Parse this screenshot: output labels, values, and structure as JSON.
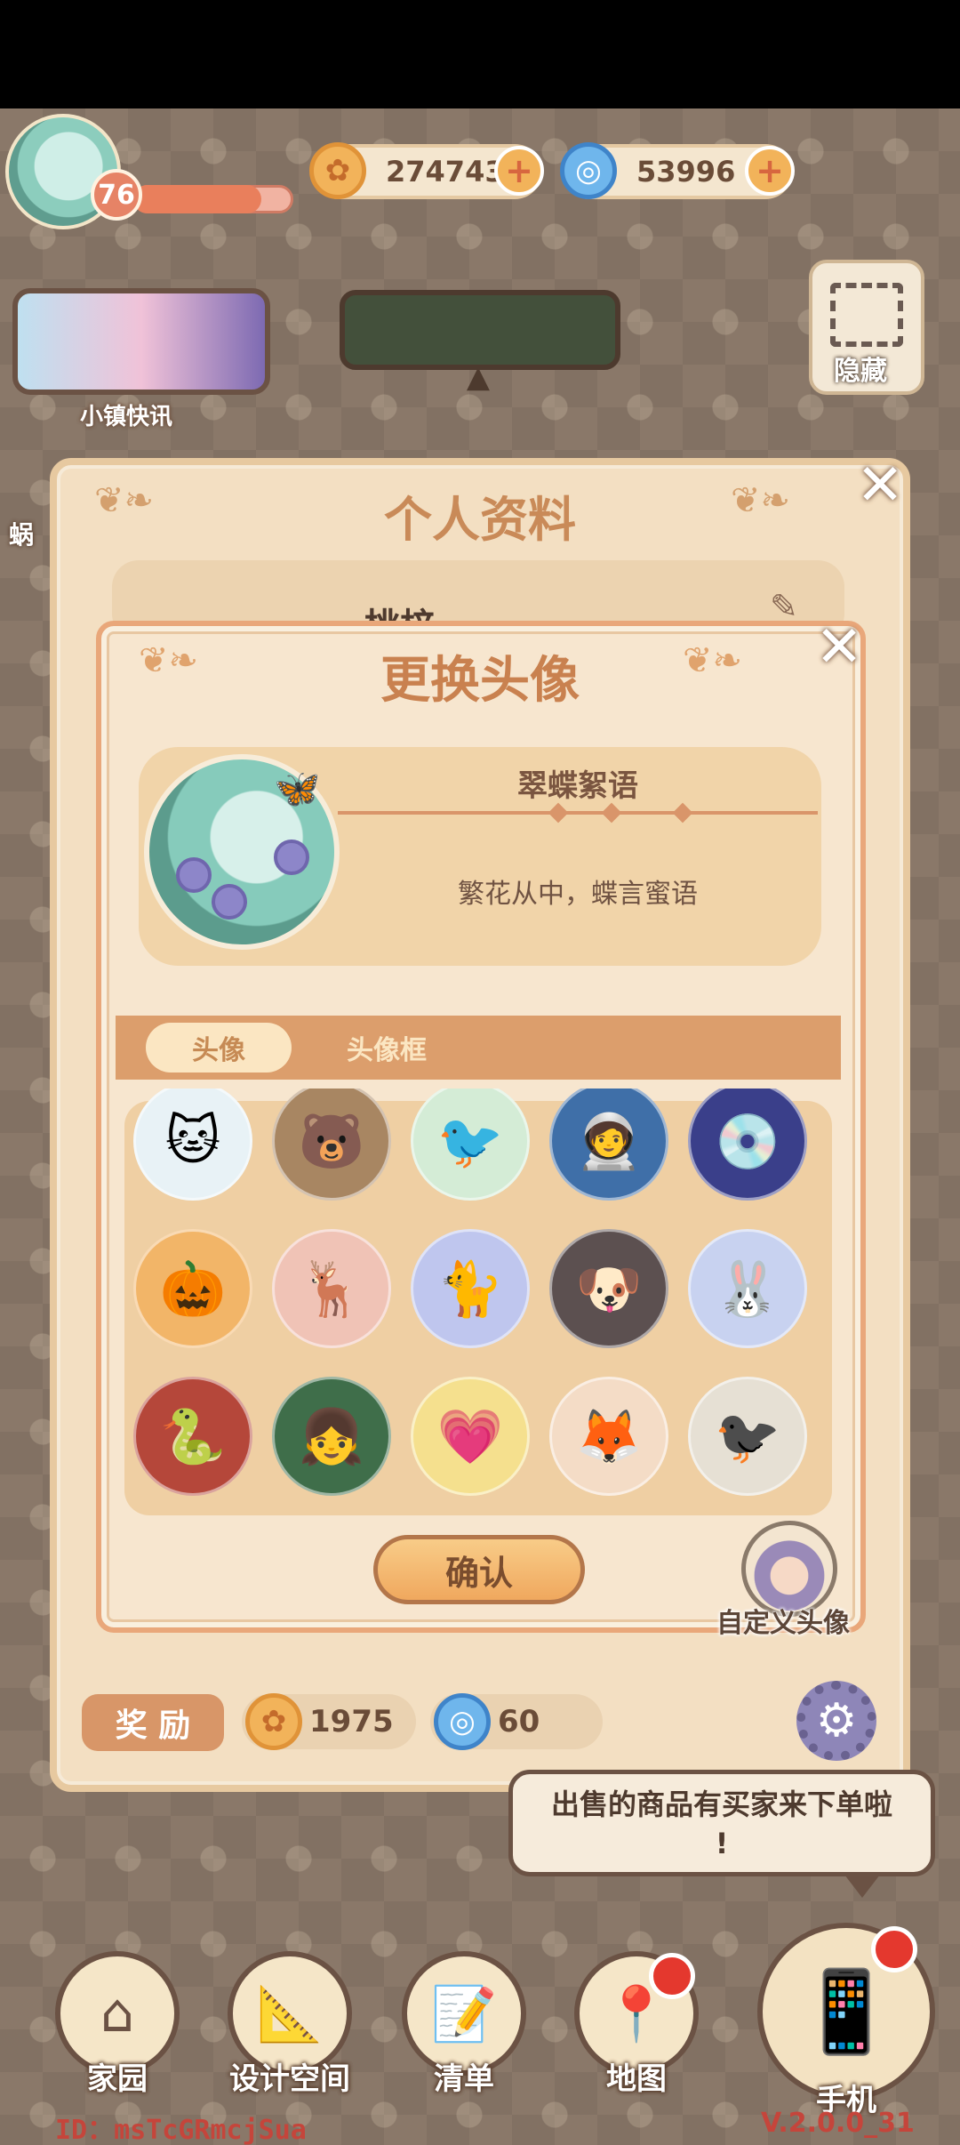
{
  "hud": {
    "level": "76",
    "xp_progress": 0.8,
    "coins": "274743",
    "gems": "53996",
    "news_label": "小镇快讯",
    "hide_label": "隐藏",
    "left_partial_label": "蜗"
  },
  "profile_panel": {
    "title": "个人资料",
    "name_partial": "桃梓",
    "reward_label": "奖 励",
    "reward_coins": "1975",
    "reward_gems": "60"
  },
  "avatar_dialog": {
    "title": "更换头像",
    "selected_name": "翠蝶絮语",
    "selected_desc": "繁花从中，蝶言蜜语",
    "tabs": [
      {
        "label": "头像",
        "active": true
      },
      {
        "label": "头像框",
        "active": false
      }
    ],
    "avatars": [
      {
        "name": "white-cat-avatar",
        "glyph": "🐱",
        "bg": "#e8f2f6"
      },
      {
        "name": "brown-bear-avatar",
        "glyph": "🐻",
        "bg": "#a88662"
      },
      {
        "name": "green-bird-avatar",
        "glyph": "🐦",
        "bg": "#d4ecd6"
      },
      {
        "name": "astronaut-cat-avatar",
        "glyph": "🧑‍🚀",
        "bg": "#3f6fa8"
      },
      {
        "name": "vinyl-record-avatar",
        "glyph": "💿",
        "bg": "#3a3f8a"
      },
      {
        "name": "pumpkin-avatar",
        "glyph": "🎃",
        "bg": "#f2b568"
      },
      {
        "name": "reindeer-avatar",
        "glyph": "🦌",
        "bg": "#f0c3b6"
      },
      {
        "name": "white-cat-blue-avatar",
        "glyph": "🐈",
        "bg": "#bfc6ee"
      },
      {
        "name": "shiba-avatar",
        "glyph": "🐶",
        "bg": "#5c5050"
      },
      {
        "name": "white-rabbit-avatar",
        "glyph": "🐰",
        "bg": "#c8d2f0"
      },
      {
        "name": "golden-snake-avatar",
        "glyph": "🐍",
        "bg": "#b5473a"
      },
      {
        "name": "bear-hood-girl-avatar",
        "glyph": "👧",
        "bg": "#3f6e4a"
      },
      {
        "name": "heart-bear-avatar",
        "glyph": "💗",
        "bg": "#f5e08e"
      },
      {
        "name": "fox-avatar",
        "glyph": "🦊",
        "bg": "#f4dcc6"
      },
      {
        "name": "magpie-avatar",
        "glyph": "🐦‍⬛",
        "bg": "#e6e0d4"
      }
    ],
    "confirm_label": "确认",
    "custom_label": "自定义头像"
  },
  "toast": {
    "text_line1": "出售的商品有买家来下单啦",
    "text_line2": "!"
  },
  "bottom_nav": {
    "home": "家园",
    "design": "设计空间",
    "list": "清单",
    "map": "地图",
    "phone": "手机"
  },
  "footer": {
    "id_text": "ID：msTcGRmcjSua",
    "version": "V.2.0.0_31"
  },
  "colors": {
    "accent": "#c9814f",
    "panel": "#f7e6cf",
    "tab_bar": "#dc9e6c",
    "badge_red": "#e4382e"
  }
}
